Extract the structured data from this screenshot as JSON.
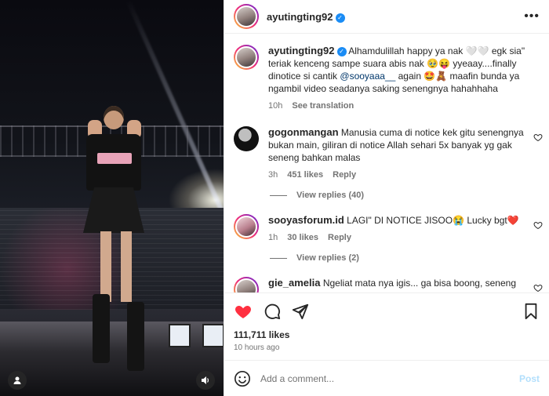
{
  "post": {
    "username": "ayutingting92",
    "caption_text": "Alhamdulillah happy ya nak 🤍🤍 egk sia\" teriak kenceng sampe suara abis nak 🥹😝 yyeaay....finally dinotice si cantik",
    "caption_mention": "@sooyaaa__",
    "caption_tail": " again 🤩🧸 maafin bunda ya ngambil video seadanya saking senengnya hahahhaha",
    "caption_time": "10h",
    "see_translation": "See translation",
    "likes": "111,711 likes",
    "posted": "10 hours ago"
  },
  "comments": [
    {
      "username": "gogonmangan",
      "text": "Manusia cuma di notice kek gitu senengnya bukan main, giliran di notice Allah sehari 5x banyak yg gak seneng bahkan malas",
      "time": "3h",
      "likes": "451 likes",
      "reply": "Reply",
      "view_replies": "View replies (40)"
    },
    {
      "username": "sooyasforum.id",
      "text": "LAGI\" DI NOTICE JISOO😭 Lucky bgt❤️",
      "time": "1h",
      "likes": "30 likes",
      "reply": "Reply",
      "view_replies": "View replies (2)"
    },
    {
      "username": "gie_amelia",
      "text": "Ngeliat mata nya igis... ga bisa boong, seneng"
    }
  ],
  "comment_box": {
    "placeholder": "Add a comment...",
    "post_label": "Post"
  },
  "icons": {
    "like": "heart-icon",
    "comment": "comment-icon",
    "share": "share-icon",
    "save": "bookmark-icon",
    "emoji": "emoji-icon",
    "more": "more-icon",
    "verified": "verified-badge-icon",
    "user_tag": "user-tag-icon",
    "audio": "audio-icon"
  },
  "colors": {
    "like_red": "#ff3040",
    "verified_blue": "#1a8cf5",
    "post_disabled": "#b2dffc",
    "mention": "#00376b"
  }
}
